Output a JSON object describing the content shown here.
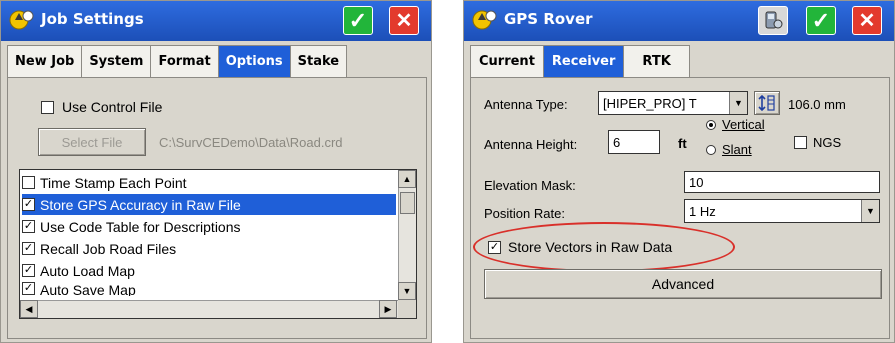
{
  "job_settings": {
    "title": "Job Settings",
    "tabs": [
      "New Job",
      "System",
      "Format",
      "Options",
      "Stake"
    ],
    "use_control_file_label": "Use Control File",
    "select_file_label": "Select File",
    "file_path": "C:\\SurvCEDemo\\Data\\Road.crd",
    "options": [
      {
        "label": "Time Stamp Each Point",
        "check": ""
      },
      {
        "label": "Store GPS Accuracy in Raw File",
        "check": "✓"
      },
      {
        "label": "Use Code Table for Descriptions",
        "check": "✓"
      },
      {
        "label": "Recall Job Road Files",
        "check": "✓"
      },
      {
        "label": "Auto Load Map",
        "check": "✓"
      },
      {
        "label": "Auto Save Map",
        "check": "✓"
      }
    ]
  },
  "gps_rover": {
    "title": "GPS Rover",
    "tabs": [
      "Current",
      "Receiver",
      "RTK"
    ],
    "antenna_type_label": "Antenna Type:",
    "antenna_type_value": "[HIPER_PRO] T",
    "antenna_offset": "106.0 mm",
    "antenna_height_label": "Antenna Height:",
    "antenna_height_value": "6",
    "unit": "ft",
    "vertical_label": "Vertical",
    "slant_label": "Slant",
    "ngs_label": "NGS",
    "elevation_mask_label": "Elevation Mask:",
    "elevation_mask_value": "10",
    "position_rate_label": "Position Rate:",
    "position_rate_value": "1 Hz",
    "store_vectors_label": "Store Vectors in Raw Data",
    "advanced_label": "Advanced"
  },
  "icons": {
    "check_mark": "✓",
    "close_mark": "✕",
    "arrow_up": "▲",
    "arrow_down": "▼",
    "arrow_left": "◀",
    "arrow_right": "▶"
  },
  "colors": {
    "title_blue": "#1f5fd8",
    "ok_green": "#22b53a",
    "close_red": "#e33a2d",
    "annotation_red": "#d9302a"
  }
}
